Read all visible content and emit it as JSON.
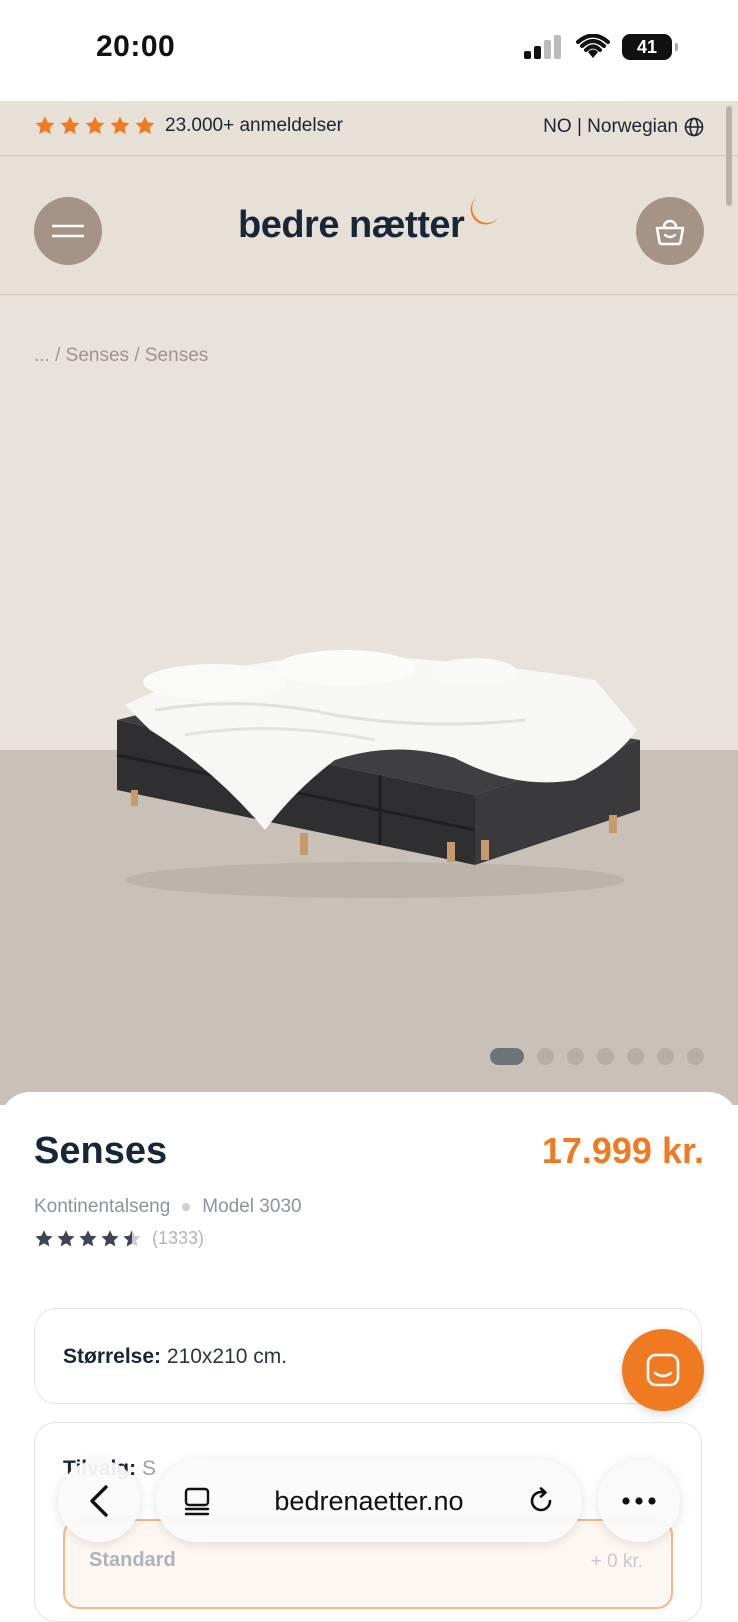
{
  "status": {
    "time": "20:00",
    "battery": "41"
  },
  "promo": {
    "reviews_text": "23.000+ anmeldelser",
    "locale": "NO | Norwegian",
    "star_color": "#f07a22"
  },
  "header": {
    "logo_text": "bedre nætter"
  },
  "breadcrumb": "... / Senses / Senses",
  "carousel": {
    "total": 7,
    "active": 1
  },
  "product": {
    "name": "Senses",
    "price": "17.999 kr.",
    "category": "Kontinentalseng",
    "model": "Model 3030",
    "rating": 4.5,
    "review_count": "(1333)"
  },
  "size": {
    "label": "Størrelse:",
    "value": "210x210 cm."
  },
  "tilvalg": {
    "label": "Tilvalg:",
    "value": "S",
    "options": [
      {
        "name": "Standard",
        "price": "+ 0 kr."
      }
    ]
  },
  "browser": {
    "url": "bedrenaetter.no"
  },
  "colors": {
    "accent": "#f07a22",
    "header_bg": "#e6e0d7",
    "button_bg": "#a59387",
    "text_dark": "#18263a"
  }
}
